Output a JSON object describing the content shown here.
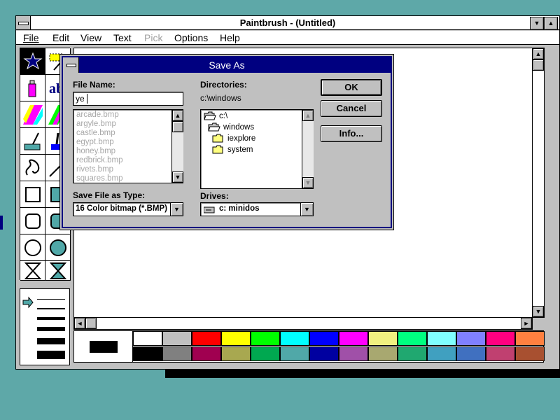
{
  "app": {
    "title": "Paintbrush - (Untitled)",
    "menu": [
      "File",
      "Edit",
      "View",
      "Text",
      "Pick",
      "Options",
      "Help"
    ],
    "menu_disabled": [
      "Pick"
    ]
  },
  "palette": {
    "top": [
      "#ffffff",
      "#c0c0c0",
      "#ff0000",
      "#ffff00",
      "#00ff00",
      "#00ffff",
      "#0000ff",
      "#ff00ff",
      "#f0f080",
      "#00ff80",
      "#80ffff",
      "#8080ff",
      "#ff0080",
      "#ff8040"
    ],
    "bottom": [
      "#000000",
      "#808080",
      "#a00050",
      "#a8a850",
      "#00a850",
      "#50a8a8",
      "#0000a0",
      "#a050a8",
      "#a8a870",
      "#20a870",
      "#40a0c0",
      "#4070c0",
      "#c04070",
      "#a85030"
    ]
  },
  "dialog": {
    "title": "Save As",
    "file_name_label": "File Name:",
    "file_name_value": "ye",
    "files": [
      "arcade.bmp",
      "argyle.bmp",
      "castle.bmp",
      "egypt.bmp",
      "honey.bmp",
      "redbrick.bmp",
      "rivets.bmp",
      "squares.bmp"
    ],
    "directories_label": "Directories:",
    "current_dir": "c:\\windows",
    "dirs": [
      "c:\\",
      "windows",
      "iexplore",
      "system"
    ],
    "save_type_label": "Save File as Type:",
    "save_type_value": "16 Color bitmap (*.BMP)",
    "drives_label": "Drives:",
    "drive_value": "c: minidos",
    "ok_label": "OK",
    "cancel_label": "Cancel",
    "info_label": "Info..."
  }
}
